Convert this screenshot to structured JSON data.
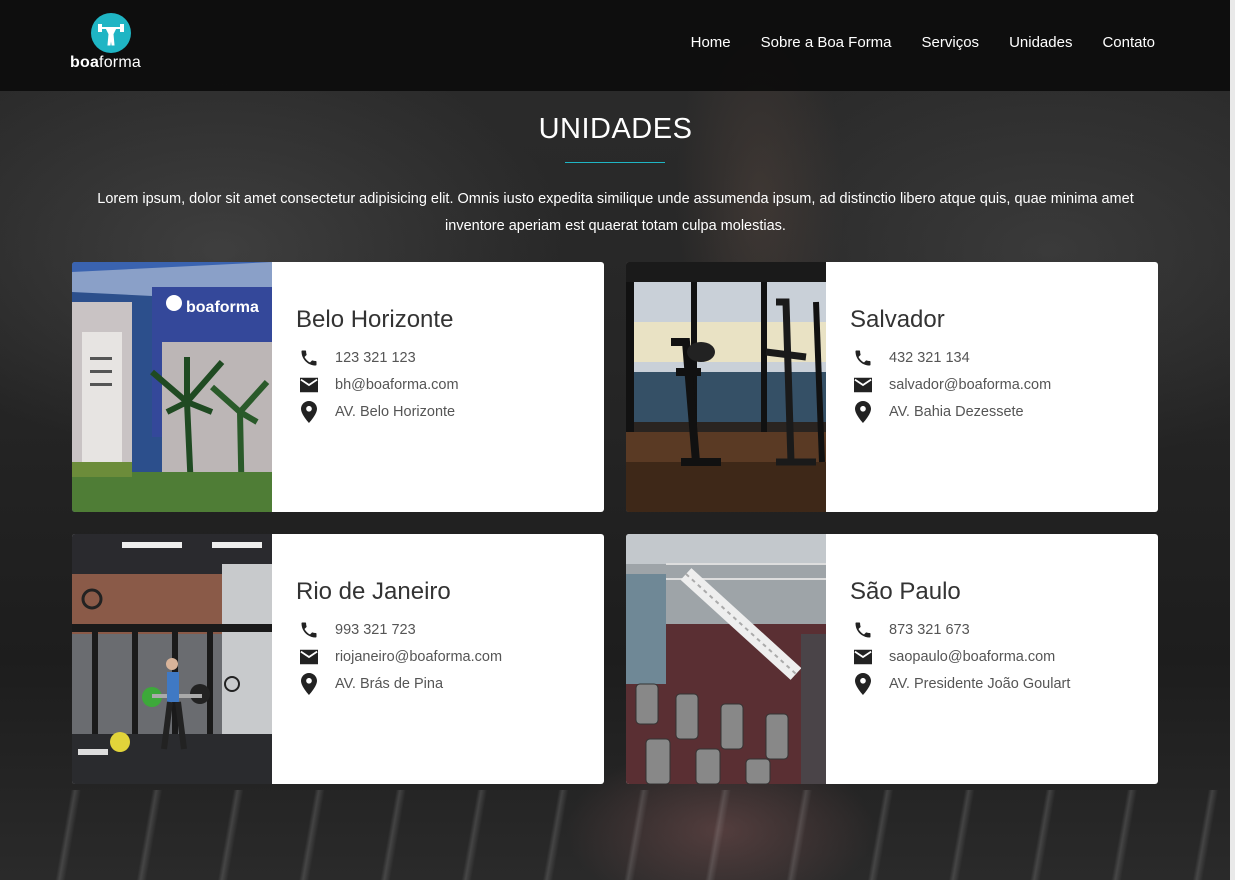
{
  "header": {
    "logo": {
      "text_bold": "boa",
      "text_regular": "forma",
      "icon": "weightlifter-icon"
    },
    "nav": [
      "Home",
      "Sobre a Boa Forma",
      "Serviços",
      "Unidades",
      "Contato"
    ]
  },
  "section": {
    "title": "UNIDADES",
    "accent_color": "#1fb5c4",
    "intro": "Lorem ipsum, dolor sit amet consectetur adipisicing elit. Omnis iusto expedita similique unde assumenda ipsum, ad distinctio libero atque quis, quae minima amet inventore aperiam est quaerat totam culpa molestias."
  },
  "units": [
    {
      "city": "Belo Horizonte",
      "phone": "123 321 123",
      "email": "bh@boaforma.com",
      "address": "AV. Belo Horizonte",
      "image_sign": "boaforma"
    },
    {
      "city": "Salvador",
      "phone": "432 321 134",
      "email": "salvador@boaforma.com",
      "address": "AV. Bahia Dezessete"
    },
    {
      "city": "Rio de Janeiro",
      "phone": "993 321 723",
      "email": "riojaneiro@boaforma.com",
      "address": "AV. Brás de Pina"
    },
    {
      "city": "São Paulo",
      "phone": "873 321 673",
      "email": "saopaulo@boaforma.com",
      "address": "AV. Presidente João Goulart"
    }
  ],
  "icons": {
    "phone": "phone-icon",
    "email": "email-icon",
    "address": "location-pin-icon"
  }
}
